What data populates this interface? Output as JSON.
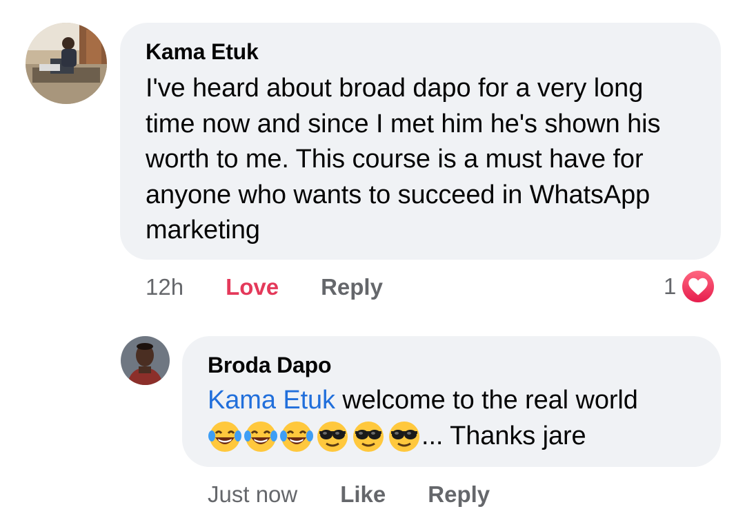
{
  "comment": {
    "author": "Kama Etuk",
    "text": "I've heard about broad dapo for a very long time now and since I met him he's shown his worth to me. This course is a must have for anyone who wants to succeed in WhatsApp marketing",
    "time": "12h",
    "love_label": "Love",
    "reply_label": "Reply",
    "reaction_count": "1",
    "reaction_type": "love-icon"
  },
  "reply": {
    "author": "Broda Dapo",
    "mention": "Kama Etuk",
    "text_after_mention": " welcome to the real world",
    "emojis": [
      "laughing-tears-icon",
      "laughing-tears-icon",
      "laughing-tears-icon",
      "sunglasses-face-icon",
      "sunglasses-face-icon",
      "sunglasses-face-icon"
    ],
    "text_after_emojis": "... Thanks jare",
    "time": "Just now",
    "like_label": "Like",
    "reply_label": "Reply"
  },
  "colors": {
    "bubble": "#f0f2f5",
    "meta_gray": "#65676b",
    "love_red": "#e4395a",
    "mention_blue": "#216fdb"
  }
}
